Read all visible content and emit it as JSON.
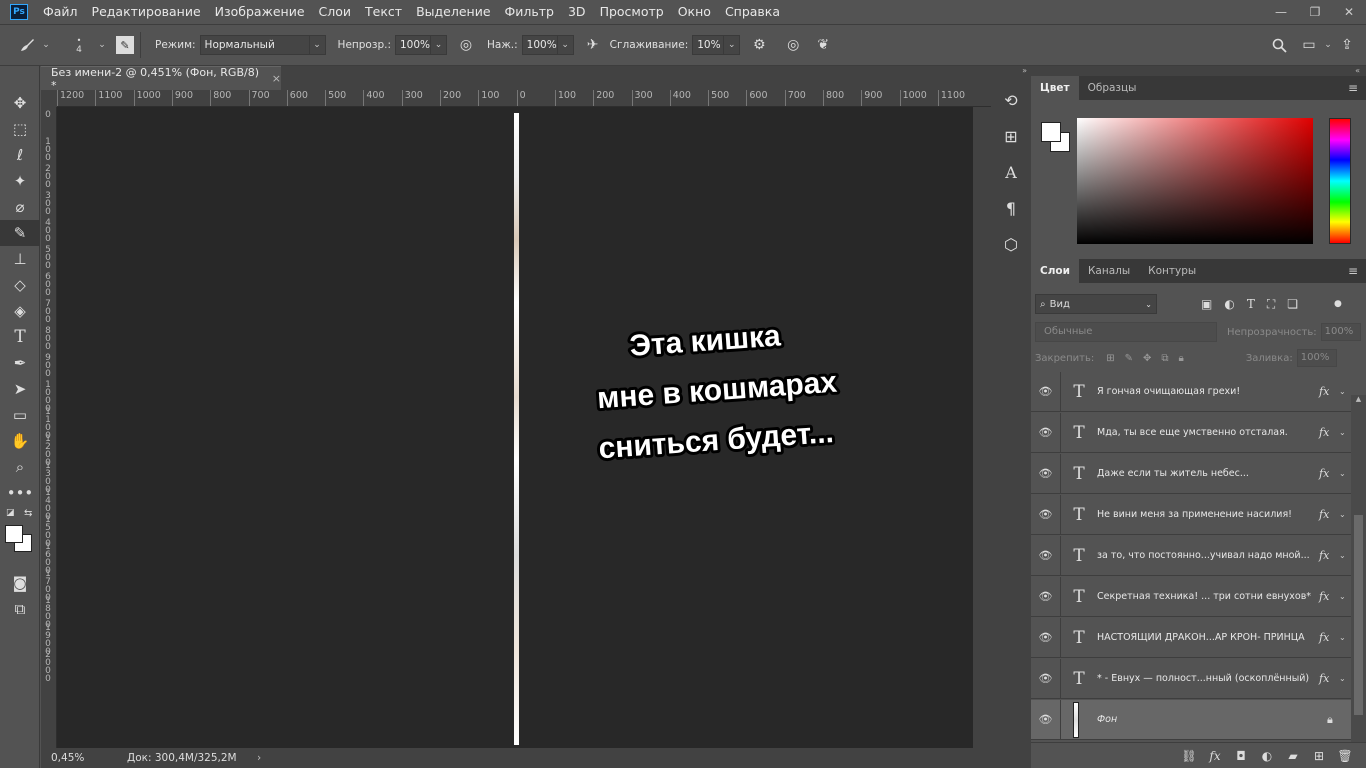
{
  "app": {
    "logo": "Ps"
  },
  "menu": [
    "Файл",
    "Редактирование",
    "Изображение",
    "Слои",
    "Текст",
    "Выделение",
    "Фильтр",
    "3D",
    "Просмотр",
    "Окно",
    "Справка"
  ],
  "window_controls": {
    "minimize": "—",
    "restore": "❐",
    "close": "✕"
  },
  "options": {
    "brush_size": "4",
    "mode_label": "Режим:",
    "mode_value": "Нормальный",
    "opacity_label": "Непрозр.:",
    "opacity_value": "100%",
    "flow_label": "Наж.:",
    "flow_value": "100%",
    "smoothing_label": "Сглаживание:",
    "smoothing_value": "10%"
  },
  "document": {
    "tab_title": "Без имени-2 @ 0,451% (Фон, RGB/8) *",
    "tab_close": "×",
    "zoom": "0,45%",
    "doc_info": "Док: 300,4M/325,2M",
    "speech_lines": [
      "Эта кишка",
      "мне в кошмарах",
      "сниться будет..."
    ]
  },
  "ruler_h": [
    "1200",
    "1100",
    "1000",
    "900",
    "800",
    "700",
    "600",
    "500",
    "400",
    "300",
    "200",
    "100",
    "0",
    "100",
    "200",
    "300",
    "400",
    "500",
    "600",
    "700",
    "800",
    "900",
    "1000",
    "1100"
  ],
  "ruler_v": [
    "0",
    "100",
    "200",
    "300",
    "400",
    "500",
    "600",
    "700",
    "800",
    "900",
    "1000",
    "1100",
    "1200",
    "1300",
    "1400",
    "1500",
    "1600",
    "1700",
    "1800",
    "1900",
    "2000"
  ],
  "color_panel": {
    "tabs": [
      "Цвет",
      "Образцы"
    ],
    "foreground": "#ffffff",
    "background": "#ffffff"
  },
  "layers_panel": {
    "tabs": [
      "Слои",
      "Каналы",
      "Контуры"
    ],
    "filter_label": "Вид",
    "blend_mode": "Обычные",
    "opacity_label": "Непрозрачность:",
    "opacity_value": "100%",
    "lock_label": "Закрепить:",
    "fill_label": "Заливка:",
    "fill_value": "100%",
    "layers": [
      {
        "name": "Я гончая очищающая грехи!",
        "type": "text",
        "fx": "fx"
      },
      {
        "name": "Мда, ты все еще умственно отсталая.",
        "type": "text",
        "fx": "fx"
      },
      {
        "name": "Даже если ты житель небес...",
        "type": "text",
        "fx": "fx"
      },
      {
        "name": "Не вини меня за применение насилия!",
        "type": "text",
        "fx": "fx"
      },
      {
        "name": "за то, что постоянно...учивал надо мной...",
        "type": "text",
        "fx": "fx"
      },
      {
        "name": "Секретная техника! ... три сотни евнухов*",
        "type": "text",
        "fx": "fx"
      },
      {
        "name": "НАСТОЯЩИЙ ДРАКОН...АР КРОН- ПРИНЦА",
        "type": "text",
        "fx": "fx"
      },
      {
        "name": "* - Евнух — полност...нный (оскоплённый)",
        "type": "text",
        "fx": "fx"
      }
    ],
    "background_layer": "Фон"
  }
}
